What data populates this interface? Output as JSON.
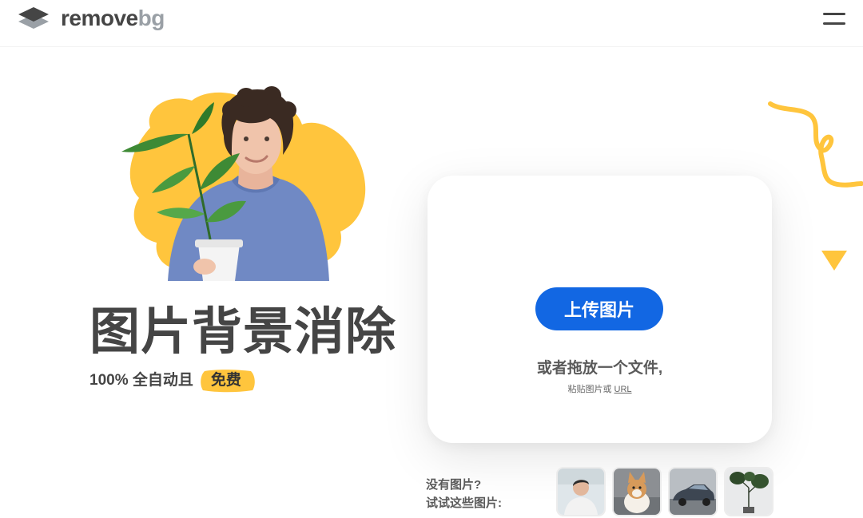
{
  "header": {
    "logo_word_primary": "remove",
    "logo_word_secondary": "bg",
    "logo_icon": "layers-diamond-icon",
    "menu_icon": "hamburger-menu-icon"
  },
  "hero": {
    "title": "图片背景消除",
    "subtitle": "100% 全自动且",
    "badge": "免费",
    "image": "man-holding-plant-image",
    "accent_color": "#ffc53d"
  },
  "upload": {
    "button_label": "上传图片",
    "drop_text": "或者拖放一个文件,",
    "paste_prefix": "粘贴图片或",
    "paste_link": "URL",
    "button_color": "#1267e3"
  },
  "samples": {
    "line1": "没有图片?",
    "line2": "试试这些图片:",
    "thumbnails": [
      "person-sample",
      "dog-sample",
      "car-sample",
      "plant-sample"
    ]
  }
}
